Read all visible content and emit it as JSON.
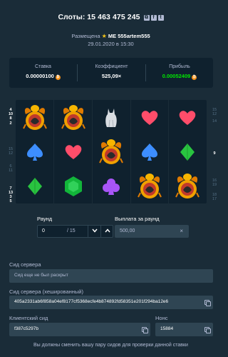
{
  "header": {
    "title_prefix": "Слоты:",
    "bet_id": "15 463 475 245",
    "copy_icon": "copy-icon",
    "social_icons": [
      "facebook-icon",
      "twitter-icon"
    ]
  },
  "placed": {
    "label": "Размещена",
    "star": "★",
    "me_badge": "ME",
    "username": "555artem555",
    "date": "29.01.2020 в 15:30"
  },
  "stats": {
    "bet_label": "Ставка",
    "bet_value": "0.00000100",
    "multiplier_label": "Коэффициент",
    "multiplier_value": "525,09×",
    "profit_label": "Прибыль",
    "profit_value": "0.00052409",
    "currency_icon": "bitcoin-icon",
    "profit_color": "#00e701"
  },
  "paylines": {
    "left": [
      "4",
      "10",
      "8",
      "2",
      "",
      "15",
      "12",
      "",
      "6",
      "11",
      "",
      "7",
      "13",
      "3",
      "5"
    ],
    "right": [
      "15",
      "12",
      "",
      "14",
      "",
      "",
      "",
      "",
      "",
      "",
      "",
      "9",
      "",
      "",
      "",
      "",
      "",
      "",
      "",
      "16",
      "",
      "19",
      "",
      "",
      "",
      "18",
      "17"
    ]
  },
  "grid": {
    "rows": [
      [
        "scarab",
        "scarab",
        "cat",
        "heart",
        "heart"
      ],
      [
        "spade",
        "heart",
        "scarab",
        "spade",
        "diamond"
      ],
      [
        "diamond",
        "emerald",
        "club",
        "scarab",
        "scarab"
      ]
    ]
  },
  "round": {
    "label": "Раунд",
    "value": "0",
    "total": "/ 15",
    "down_icon": "chevron-down-icon",
    "up_icon": "chevron-up-icon"
  },
  "payout": {
    "label": "Выплата за раунд",
    "value": "500,00",
    "close_icon": "close-icon",
    "close_glyph": "×"
  },
  "server_seed": {
    "label": "Сид сервера",
    "placeholder": "Сид еще не был раскрыт"
  },
  "server_seed_hashed": {
    "label": "Сид сервера (хешированный)",
    "value": "405a2331ab6f858a04ef8177cf5368ecfe4b874892fd58351e201f294ba12e6"
  },
  "client_seed": {
    "label": "Клиентский сид",
    "value": "f387c5297b"
  },
  "nonce": {
    "label": "Нонс",
    "value": "15884"
  },
  "footer": {
    "note": "Вы должны сменить вашу пару сидов для проверки данной ставки"
  }
}
